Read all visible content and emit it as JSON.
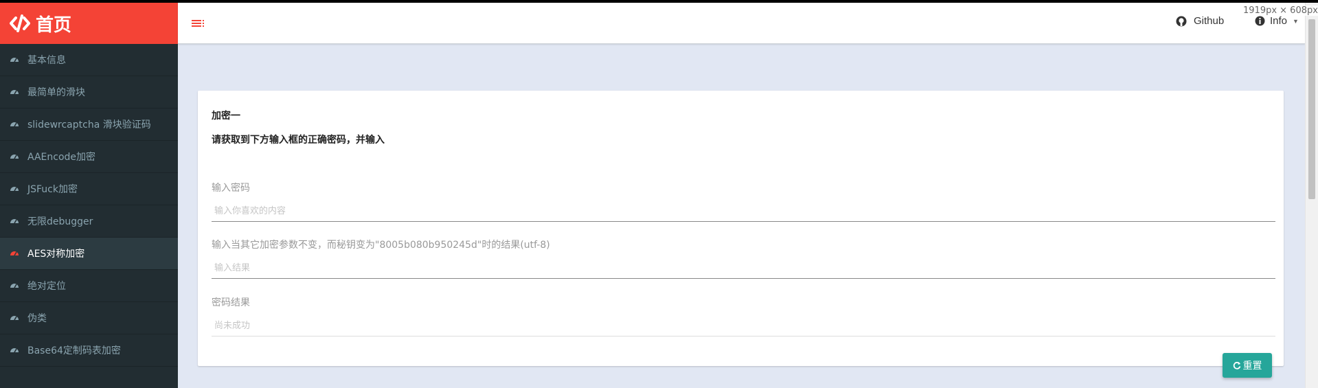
{
  "window": {
    "size_badge": "1919px × 608px"
  },
  "brand": {
    "title": "首页",
    "color": "#f44336"
  },
  "sidebar": {
    "items": [
      {
        "label": "基本信息",
        "icon": "dashboard-icon",
        "active": false
      },
      {
        "label": "最简单的滑块",
        "icon": "dashboard-icon",
        "active": false
      },
      {
        "label": "slidewrcaptcha 滑块验证码",
        "icon": "dashboard-icon",
        "active": false
      },
      {
        "label": "AAEncode加密",
        "icon": "dashboard-icon",
        "active": false
      },
      {
        "label": "JSFuck加密",
        "icon": "dashboard-icon",
        "active": false
      },
      {
        "label": "无限debugger",
        "icon": "dashboard-icon",
        "active": false
      },
      {
        "label": "AES对称加密",
        "icon": "dashboard-icon",
        "active": true
      },
      {
        "label": "绝对定位",
        "icon": "dashboard-icon",
        "active": false
      },
      {
        "label": "伪类",
        "icon": "dashboard-icon",
        "active": false
      },
      {
        "label": "Base64定制码表加密",
        "icon": "dashboard-icon",
        "active": false
      }
    ]
  },
  "header": {
    "github_label": "Github",
    "info_label": "Info"
  },
  "card": {
    "title": "加密一",
    "subtitle": "请获取到下方输入框的正确密码，并输入",
    "fields": [
      {
        "label": "输入密码",
        "placeholder": "输入你喜欢的内容",
        "value": ""
      },
      {
        "label": "输入当其它加密参数不变，而秘钥变为\"8005b080b950245d\"时的结果(utf-8)",
        "placeholder": "输入结果",
        "value": ""
      },
      {
        "label": "密码结果",
        "placeholder": "尚未成功",
        "value": ""
      }
    ],
    "reset_label": "重置"
  },
  "colors": {
    "accent": "#f44336",
    "sidebar_bg": "#222d32",
    "button": "#26a69a",
    "content_bg": "#e1e7f3"
  }
}
